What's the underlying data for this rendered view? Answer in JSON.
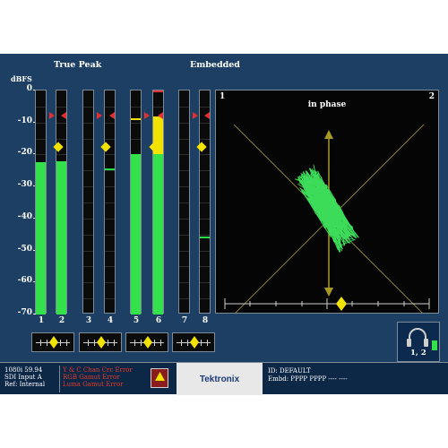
{
  "headers": {
    "true_peak": "True Peak",
    "embedded": "Embedded",
    "unit": "dBFS"
  },
  "scale_ticks": [
    "0",
    "-10",
    "-20",
    "-30",
    "-40",
    "-50",
    "-60",
    "-70"
  ],
  "channels": [
    {
      "label": "1",
      "level_db": -22.5,
      "hold_db": null,
      "hold_color": null
    },
    {
      "label": "2",
      "level_db": -22.0,
      "hold_db": null,
      "hold_color": null
    },
    {
      "label": "3",
      "level_db": null,
      "hold_db": null,
      "hold_color": null
    },
    {
      "label": "4",
      "level_db": null,
      "hold_db": -24.5,
      "hold_color": "#22dd44"
    },
    {
      "label": "5",
      "level_db": -20.0,
      "hold_db": -9.0,
      "hold_color": "#f2e200"
    },
    {
      "label": "6",
      "level_db": -8.0,
      "hold_db": -0.2,
      "hold_color": "#e03030"
    },
    {
      "label": "7",
      "level_db": null,
      "hold_db": null,
      "hold_color": null
    },
    {
      "label": "8",
      "level_db": null,
      "hold_db": -46.0,
      "hold_color": "#22dd44"
    }
  ],
  "threshold_markers": {
    "peak_db": -8.0,
    "test_db": -18.0
  },
  "phase_display": {
    "left_label": "1",
    "right_label": "2",
    "title": "in phase"
  },
  "surround": {
    "label": "1, 2"
  },
  "status": {
    "format": "1080i 59.94",
    "input": "SDI Input A",
    "ref": "Ref: Internal",
    "errors": [
      "Y & C Chan Crc Error",
      "RGB Gamut Error",
      "Luma Gamut Error"
    ],
    "brand": "Tektronix",
    "id": "ID: DEFAULT",
    "embd": "Embd: PPPP PPPP ---- ----"
  },
  "colors": {
    "background": "#1d3f63",
    "meter_green": "#33e14a",
    "meter_yellow": "#f2e200",
    "meter_red": "#e03030",
    "lissajous": "#3ddc5a",
    "error_text": "#e43b2a"
  }
}
